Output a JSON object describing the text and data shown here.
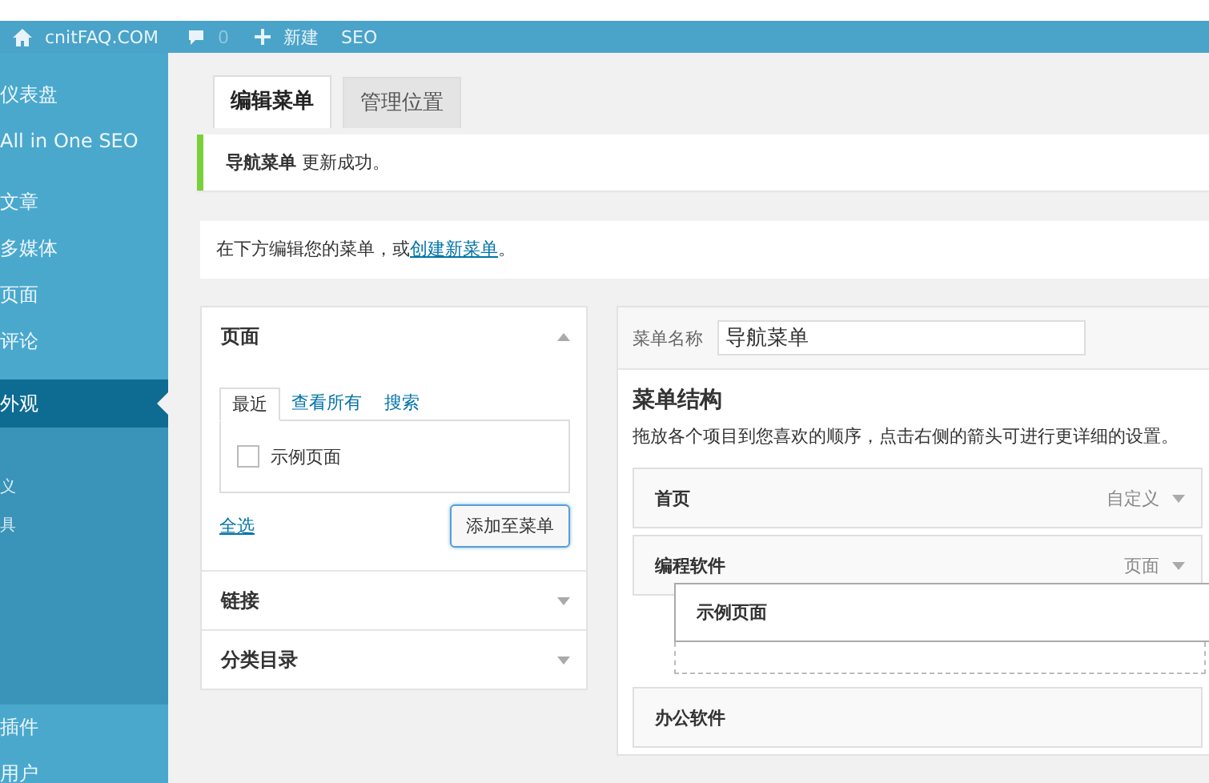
{
  "admin_bar": {
    "site": "cnitFAQ.COM",
    "comments": "0",
    "new": "新建",
    "seo": "SEO"
  },
  "sidebar": {
    "groups": [
      {
        "items": [
          {
            "label": "仪表盘",
            "selected": false
          },
          {
            "label": "All in One SEO",
            "selected": false
          }
        ]
      },
      {
        "items": [
          {
            "label": "文章",
            "selected": false
          },
          {
            "label": "多媒体",
            "selected": false
          },
          {
            "label": "页面",
            "selected": false
          },
          {
            "label": "评论",
            "selected": false
          }
        ]
      },
      {
        "items": [
          {
            "label": "外观",
            "selected": true,
            "children": [
              {
                "label": "义"
              },
              {
                "label": "具"
              }
            ]
          },
          {
            "label": "插件",
            "selected": false
          },
          {
            "label": "用户",
            "selected": false
          }
        ]
      }
    ]
  },
  "tabs": [
    {
      "label": "编辑菜单",
      "selected": true
    },
    {
      "label": "管理位置",
      "selected": false
    }
  ],
  "notice": {
    "text": "**导航菜单** 更新成功。"
  },
  "info": {
    "text": "在下方编辑您的菜单，或",
    "link": "创建新菜单",
    "end": "。"
  },
  "add_panels": [
    {
      "title": "页面",
      "expanded": true,
      "tabs": [
        {
          "label": "最近",
          "selected": true
        },
        {
          "label": "查看所有",
          "selected": false
        },
        {
          "label": "搜索",
          "selected": false
        }
      ],
      "items": [
        {
          "label": "示例页面",
          "checked": false
        }
      ],
      "select_all": "全选",
      "button": "添加至菜单"
    },
    {
      "title": "链接",
      "expanded": false
    },
    {
      "title": "分类目录",
      "expanded": false
    }
  ],
  "menu_name": {
    "label": "菜单名称",
    "value": "导航菜单"
  },
  "structure": {
    "title": "菜单结构",
    "hint": "拖放各个项目到您喜欢的顺序，点击右侧的箭头可进行更详细的设置。",
    "items": [
      {
        "kind": "item",
        "label": "首页",
        "type": "自定义"
      },
      {
        "kind": "item",
        "label": "编程软件",
        "type": "页面"
      },
      {
        "kind": "dragging",
        "label": "示例页面"
      },
      {
        "kind": "item",
        "label": "办公软件"
      }
    ]
  }
}
